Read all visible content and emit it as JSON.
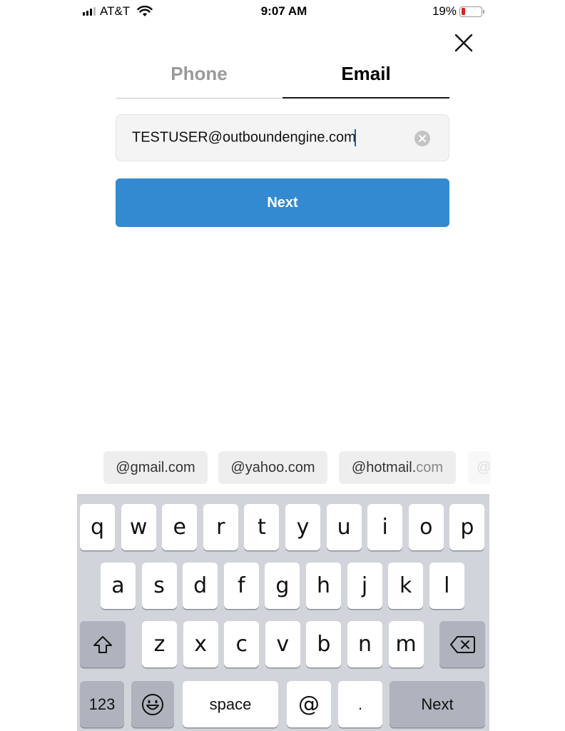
{
  "status_bar": {
    "carrier": "AT&T",
    "time": "9:07 AM",
    "battery_percent": "19%",
    "battery_level": 0.19,
    "icons": [
      "signal-icon",
      "wifi-icon",
      "battery-icon"
    ]
  },
  "close_icon": "close-icon",
  "tabs": [
    {
      "label": "Phone",
      "active": false
    },
    {
      "label": "Email",
      "active": true
    }
  ],
  "email_input": {
    "value": "TESTUSER@outboundengine.com",
    "clear_icon": "clear-circle-icon"
  },
  "next_button": {
    "label": "Next",
    "color": "#348ad0"
  },
  "suggestions": [
    {
      "prefix": "@gmail.com",
      "suffix": ""
    },
    {
      "prefix": "@yahoo.com",
      "suffix": ""
    },
    {
      "prefix": "@hotmail.",
      "suffix": "com"
    },
    {
      "prefix": "@",
      "suffix": ""
    }
  ],
  "keyboard": {
    "row1": [
      "q",
      "w",
      "e",
      "r",
      "t",
      "y",
      "u",
      "i",
      "o",
      "p"
    ],
    "row2": [
      "a",
      "s",
      "d",
      "f",
      "g",
      "h",
      "j",
      "k",
      "l"
    ],
    "row3": [
      "z",
      "x",
      "c",
      "v",
      "b",
      "n",
      "m"
    ],
    "shift_icon": "shift-icon",
    "delete_icon": "backspace-icon",
    "numbers_label": "123",
    "emoji_icon": "emoji-icon",
    "space_label": "space",
    "at_label": "@",
    "dot_label": ".",
    "return_label": "Next"
  }
}
